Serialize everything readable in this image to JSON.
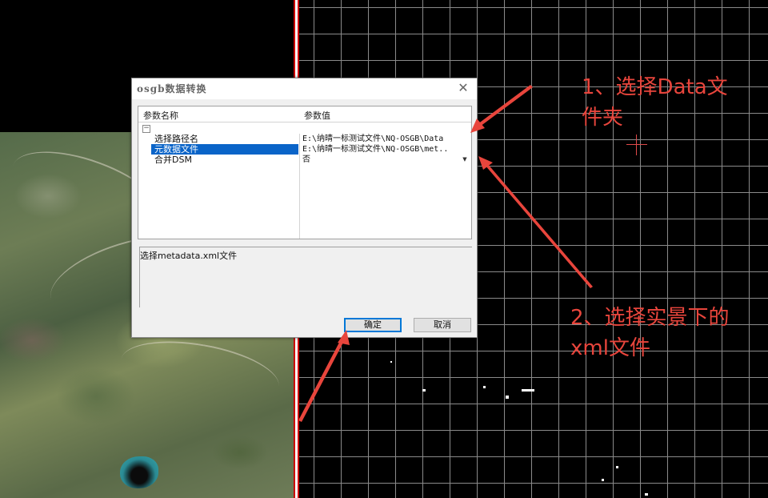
{
  "dialog": {
    "title": "osgb数据转换",
    "close_glyph": "✕",
    "columns": {
      "name": "参数名称",
      "value": "参数值"
    },
    "category_expander": "−",
    "rows": [
      {
        "name": "选择路径名",
        "value": "E:\\纳晴一标测试文件\\NQ-OSGB\\Data"
      },
      {
        "name": "元数据文件",
        "value": "E:\\纳晴一标测试文件\\NQ-OSGB\\met..",
        "selected": true
      },
      {
        "name": "合并DSM",
        "value": "否",
        "dropdown": "▼"
      }
    ],
    "description": "选择metadata.xml文件",
    "ok_label": "确定",
    "cancel_label": "取消"
  },
  "annotations": {
    "step1_line1": "1、选择Data文",
    "step1_line2": "件夹",
    "step2_line1": "2、选择实景下的",
    "step2_line2": "xml文件",
    "color": "#e8453c"
  },
  "colors": {
    "selection": "#0a64c8",
    "ok_border": "#0078d7",
    "grid_line": "#8a8a8a"
  }
}
